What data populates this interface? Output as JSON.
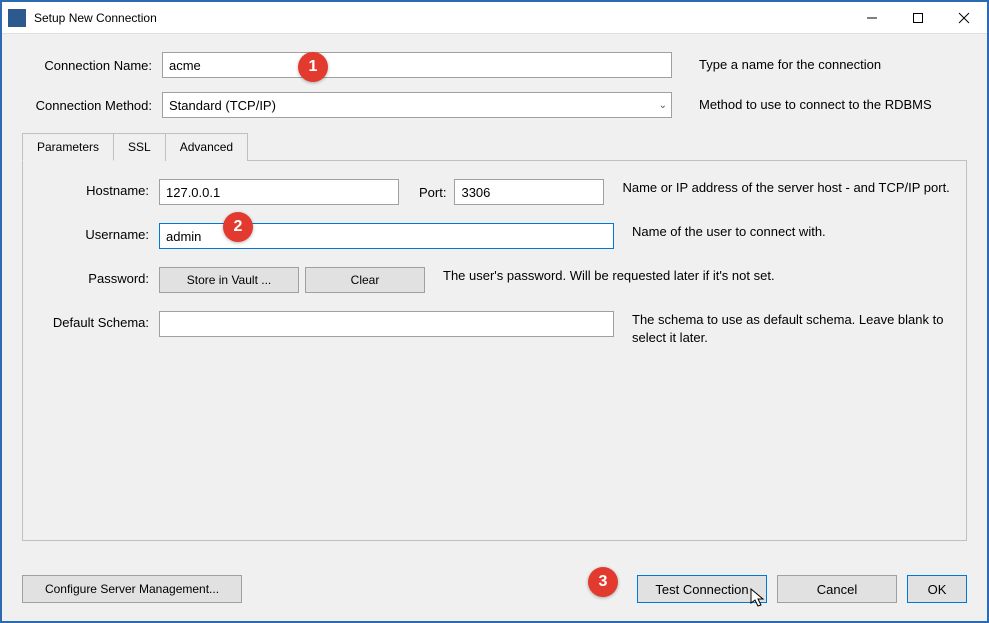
{
  "window": {
    "title": "Setup New Connection"
  },
  "form": {
    "connection_name": {
      "label": "Connection Name:",
      "value": "acme",
      "help": "Type a name for the connection"
    },
    "connection_method": {
      "label": "Connection Method:",
      "value": "Standard (TCP/IP)",
      "help": "Method to use to connect to the RDBMS"
    }
  },
  "tabs": {
    "parameters": "Parameters",
    "ssl": "SSL",
    "advanced": "Advanced"
  },
  "params": {
    "hostname": {
      "label": "Hostname:",
      "value": "127.0.0.1"
    },
    "port": {
      "label": "Port:",
      "value": "3306"
    },
    "host_help": "Name or IP address of the server host - and TCP/IP port.",
    "username": {
      "label": "Username:",
      "value": "admin",
      "help": "Name of the user to connect with."
    },
    "password": {
      "label": "Password:",
      "store_btn": "Store in Vault ...",
      "clear_btn": "Clear",
      "help": "The user's password. Will be requested later if it's not set."
    },
    "default_schema": {
      "label": "Default Schema:",
      "value": "",
      "help": "The schema to use as default schema. Leave blank to select it later."
    }
  },
  "footer": {
    "configure": "Configure Server Management...",
    "test": "Test Connection",
    "cancel": "Cancel",
    "ok": "OK"
  },
  "callouts": {
    "c1": "1",
    "c2": "2",
    "c3": "3"
  }
}
